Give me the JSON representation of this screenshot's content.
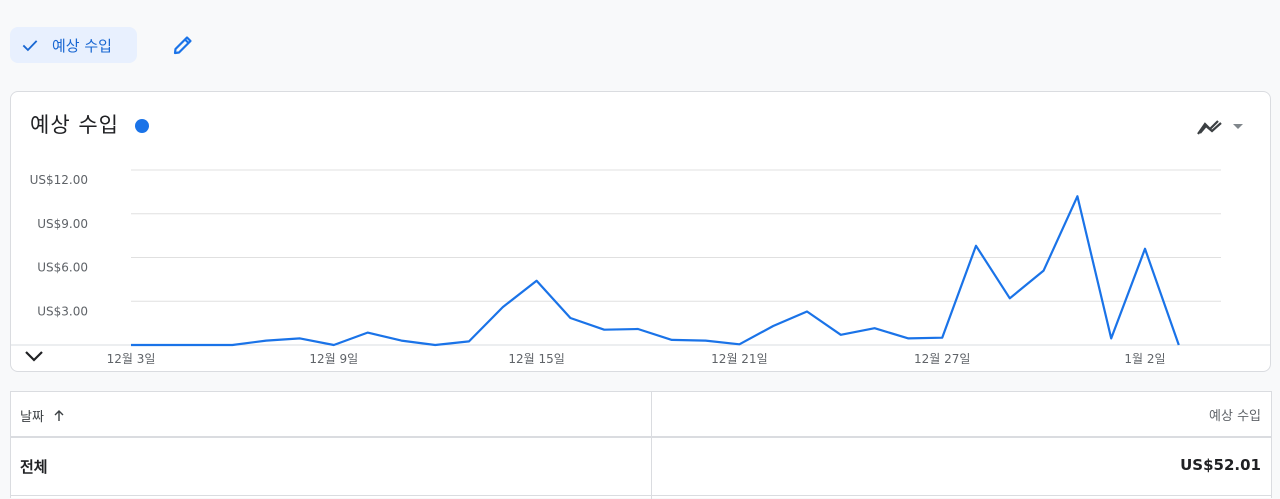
{
  "filter_chip": {
    "label": "예상 수입",
    "icon": "check-icon"
  },
  "edit": {
    "icon": "pencil-icon"
  },
  "chart_card": {
    "title": "예상 수입",
    "series_color": "#1a73e8",
    "chart_type_icon": "line-chart-icon"
  },
  "chart_data": {
    "type": "line",
    "ylim": [
      0,
      12
    ],
    "yticks": [
      "US$12.00",
      "US$9.00",
      "US$6.00",
      "US$3.00"
    ],
    "ytick_values": [
      12,
      9,
      6,
      3
    ],
    "x_tick_labels": [
      "12월 3일",
      "12월 9일",
      "12월 15일",
      "12월 21일",
      "12월 27일",
      "1월 2일"
    ],
    "x_tick_indices": [
      0,
      6,
      12,
      18,
      24,
      30
    ],
    "series": [
      {
        "color": "#1a73e8",
        "values": [
          0.0,
          0.0,
          0.0,
          0.0,
          0.3,
          0.45,
          0.0,
          0.85,
          0.3,
          0.0,
          0.25,
          2.6,
          4.4,
          1.85,
          1.05,
          1.1,
          0.35,
          0.3,
          0.05,
          1.3,
          2.3,
          0.7,
          1.15,
          0.45,
          0.5,
          6.8,
          3.2,
          5.1,
          10.2,
          0.45,
          6.6,
          0.0
        ]
      }
    ]
  },
  "table": {
    "col_date": "날짜",
    "col_revenue": "예상 수입",
    "total_label": "전체",
    "total_value": "US$52.01"
  }
}
